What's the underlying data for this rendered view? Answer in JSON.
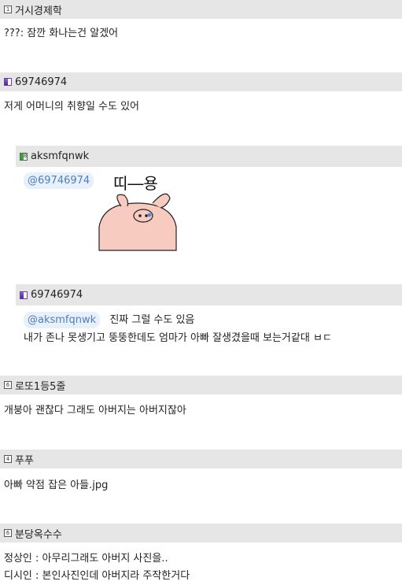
{
  "comments": [
    {
      "author": "거시경제학",
      "lines": [
        "???: 잠깐 화나는건 알겠어"
      ]
    },
    {
      "author": "69746974",
      "lines": [
        "저게 어머니의 취향일 수도 있어"
      ]
    },
    {
      "author": "aksmfqnwk",
      "mention": "@69746974",
      "sticker_caption": "띠―용"
    },
    {
      "author": "69746974",
      "mention": "@aksmfqnwk",
      "lines": [
        "진짜 그럴 수도 있음",
        "내가 존나 못생기고 뚱뚱한데도 엄마가 아빠 잘생겼을때 보는거같대 ㅂㄷ"
      ]
    },
    {
      "author": "로또1등5줄",
      "lines": [
        "개붕아 괜찮다 그래도 아버지는 아버지잖아"
      ]
    },
    {
      "author": "푸푸",
      "lines": [
        "아빠 약점 잡은 아들.jpg"
      ]
    },
    {
      "author": "분당옥수수",
      "lines": [
        "정상인 : 아무리그래도 아버지 사진을..",
        "디시인 : 본인사진인데 아버지라 주작한거다"
      ]
    }
  ]
}
